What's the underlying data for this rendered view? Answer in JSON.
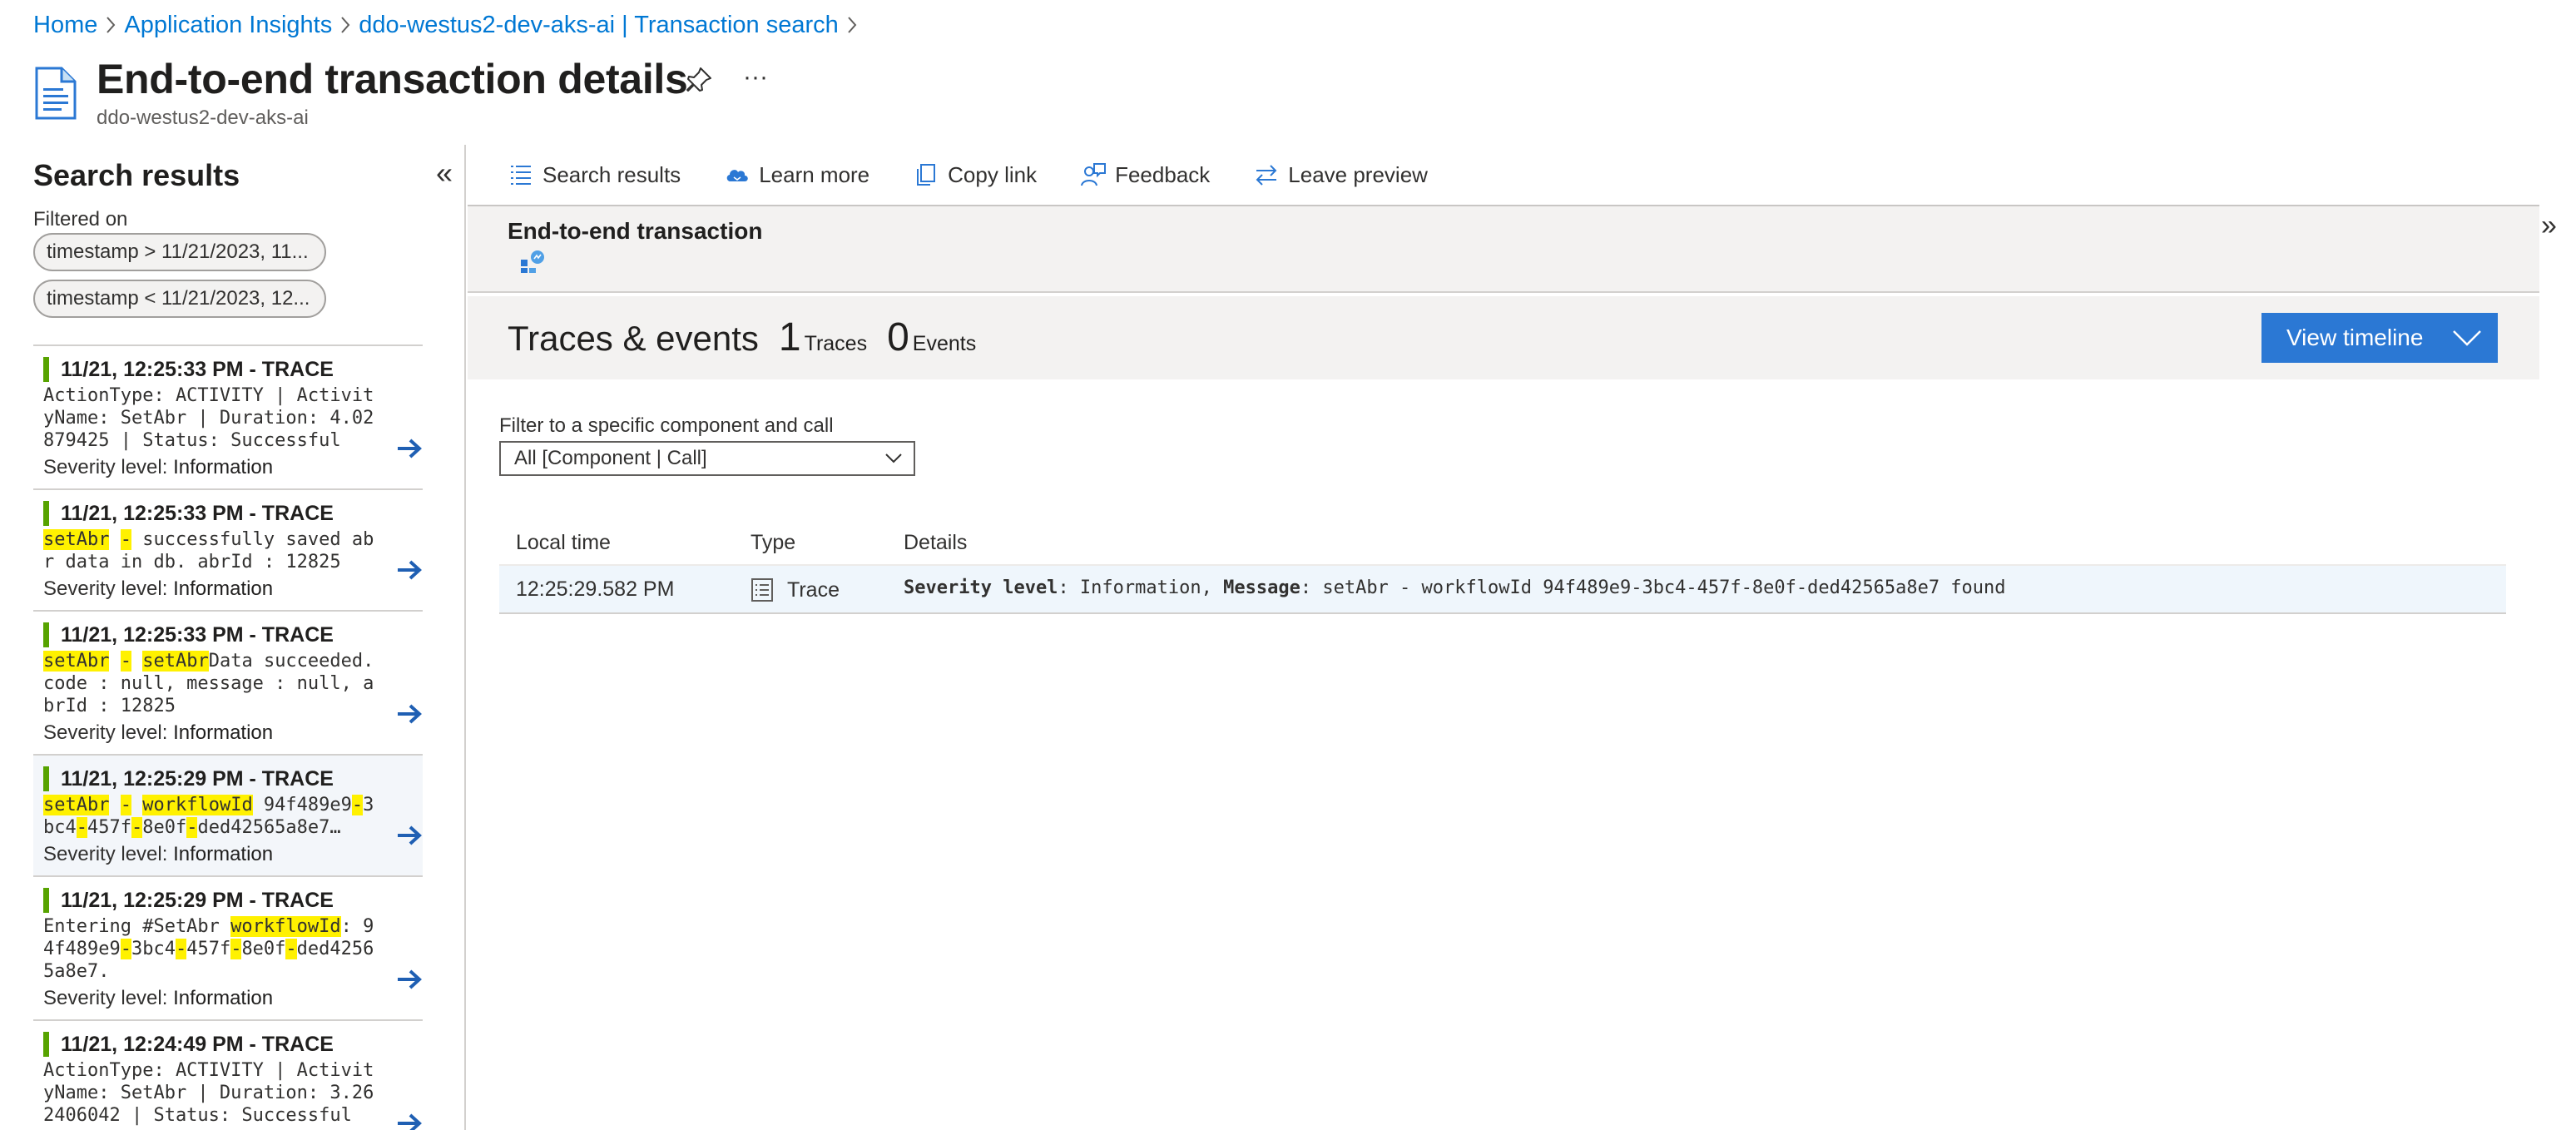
{
  "breadcrumb": {
    "items": [
      "Home",
      "Application Insights",
      "ddo-westus2-dev-aks-ai | Transaction search"
    ]
  },
  "header": {
    "title": "End-to-end transaction details",
    "subtitle": "ddo-westus2-dev-aks-ai",
    "more_label": "···",
    "icons": {
      "doc": "document-icon",
      "pin": "pin-icon",
      "more": "more-icon"
    }
  },
  "left_pane": {
    "title": "Search results",
    "collapse_label": "«",
    "filtered_label": "Filtered on",
    "filters": [
      "timestamp > 11/21/2023, 11...",
      "timestamp < 11/21/2023, 12..."
    ],
    "results": [
      {
        "header": "11/21, 12:25:33 PM - TRACE",
        "lines": [
          [
            {
              "t": "ActionType: ACTIVITY | Activit"
            }
          ],
          [
            {
              "t": "yName: SetAbr | Duration: 4.02"
            }
          ],
          [
            {
              "t": "879425 | Status: Successful"
            }
          ]
        ],
        "severity_label": "Severity level:",
        "severity_value": "Information"
      },
      {
        "header": "11/21, 12:25:33 PM - TRACE",
        "lines": [
          [
            {
              "t": "setAbr",
              "h": true
            },
            {
              "t": " "
            },
            {
              "t": "-",
              "h": true
            },
            {
              "t": " successfully saved ab"
            }
          ],
          [
            {
              "t": "r data in db. abrId : 12825"
            }
          ]
        ],
        "severity_label": "Severity level:",
        "severity_value": "Information"
      },
      {
        "header": "11/21, 12:25:33 PM - TRACE",
        "lines": [
          [
            {
              "t": "setAbr",
              "h": true
            },
            {
              "t": " "
            },
            {
              "t": "-",
              "h": true
            },
            {
              "t": " "
            },
            {
              "t": "setAbr",
              "h": true
            },
            {
              "t": "Data succeeded."
            }
          ],
          [
            {
              "t": "code : null, message : null, a"
            }
          ],
          [
            {
              "t": "brId : 12825"
            }
          ]
        ],
        "severity_label": "Severity level:",
        "severity_value": "Information"
      },
      {
        "header": "11/21, 12:25:29 PM - TRACE",
        "selected": true,
        "lines": [
          [
            {
              "t": "setAbr",
              "h": true
            },
            {
              "t": " "
            },
            {
              "t": "-",
              "h": true
            },
            {
              "t": " "
            },
            {
              "t": "workflowId",
              "h": true
            },
            {
              "t": " 94f489e9"
            },
            {
              "t": "-",
              "h": true
            },
            {
              "t": "3"
            }
          ],
          [
            {
              "t": "bc4"
            },
            {
              "t": "-",
              "h": true
            },
            {
              "t": "457f"
            },
            {
              "t": "-",
              "h": true
            },
            {
              "t": "8e0f"
            },
            {
              "t": "-",
              "h": true
            },
            {
              "t": "ded42565a8e7…"
            }
          ]
        ],
        "severity_label": "Severity level:",
        "severity_value": "Information"
      },
      {
        "header": "11/21, 12:25:29 PM - TRACE",
        "lines": [
          [
            {
              "t": "Entering #SetAbr "
            },
            {
              "t": "workflowId",
              "h": true
            },
            {
              "t": ": 9"
            }
          ],
          [
            {
              "t": "4f489e9"
            },
            {
              "t": "-",
              "h": true
            },
            {
              "t": "3bc4"
            },
            {
              "t": "-",
              "h": true
            },
            {
              "t": "457f"
            },
            {
              "t": "-",
              "h": true
            },
            {
              "t": "8e0f"
            },
            {
              "t": "-",
              "h": true
            },
            {
              "t": "ded4256"
            }
          ],
          [
            {
              "t": "5a8e7."
            }
          ]
        ],
        "severity_label": "Severity level:",
        "severity_value": "Information"
      },
      {
        "header": "11/21, 12:24:49 PM - TRACE",
        "lines": [
          [
            {
              "t": "ActionType: ACTIVITY | Activit"
            }
          ],
          [
            {
              "t": "yName: SetAbr | Duration: 3.26"
            }
          ],
          [
            {
              "t": "2406042 | Status: Successful"
            }
          ]
        ],
        "severity_label": "Severity level:",
        "severity_value": "Information"
      }
    ]
  },
  "command_bar": {
    "items": [
      {
        "label": "Search results",
        "icon": "list-icon"
      },
      {
        "label": "Learn more",
        "icon": "cloud-book-icon"
      },
      {
        "label": "Copy link",
        "icon": "copy-icon"
      },
      {
        "label": "Feedback",
        "icon": "feedback-icon"
      },
      {
        "label": "Leave preview",
        "icon": "switch-arrows-icon"
      }
    ],
    "expand_label": "»"
  },
  "e2e": {
    "title": "End-to-end transaction",
    "icon": "app-insights-icon"
  },
  "traces": {
    "title": "Traces & events",
    "traces_count": "1",
    "traces_unit": "Traces",
    "events_count": "0",
    "events_unit": "Events",
    "view_timeline_label": "View timeline"
  },
  "filter": {
    "label": "Filter to a specific component and call",
    "value": "All [Component | Call]"
  },
  "grid": {
    "columns": [
      "Local time",
      "Type",
      "Details"
    ],
    "rows": [
      {
        "time": "12:25:29.582 PM",
        "type": "Trace",
        "sev_key": "Severity level",
        "sev_val": ": Information, ",
        "msg_key": "Message",
        "msg_val": ": setAbr - workflowId 94f489e9-3bc4-457f-8e0f-ded42565a8e7 found"
      }
    ]
  },
  "colors": {
    "link": "#0078d4",
    "accent_button": "#2b78d4",
    "trace_bar": "#57a300",
    "highlight": "#fff100",
    "selected_row": "#eff6fc"
  }
}
